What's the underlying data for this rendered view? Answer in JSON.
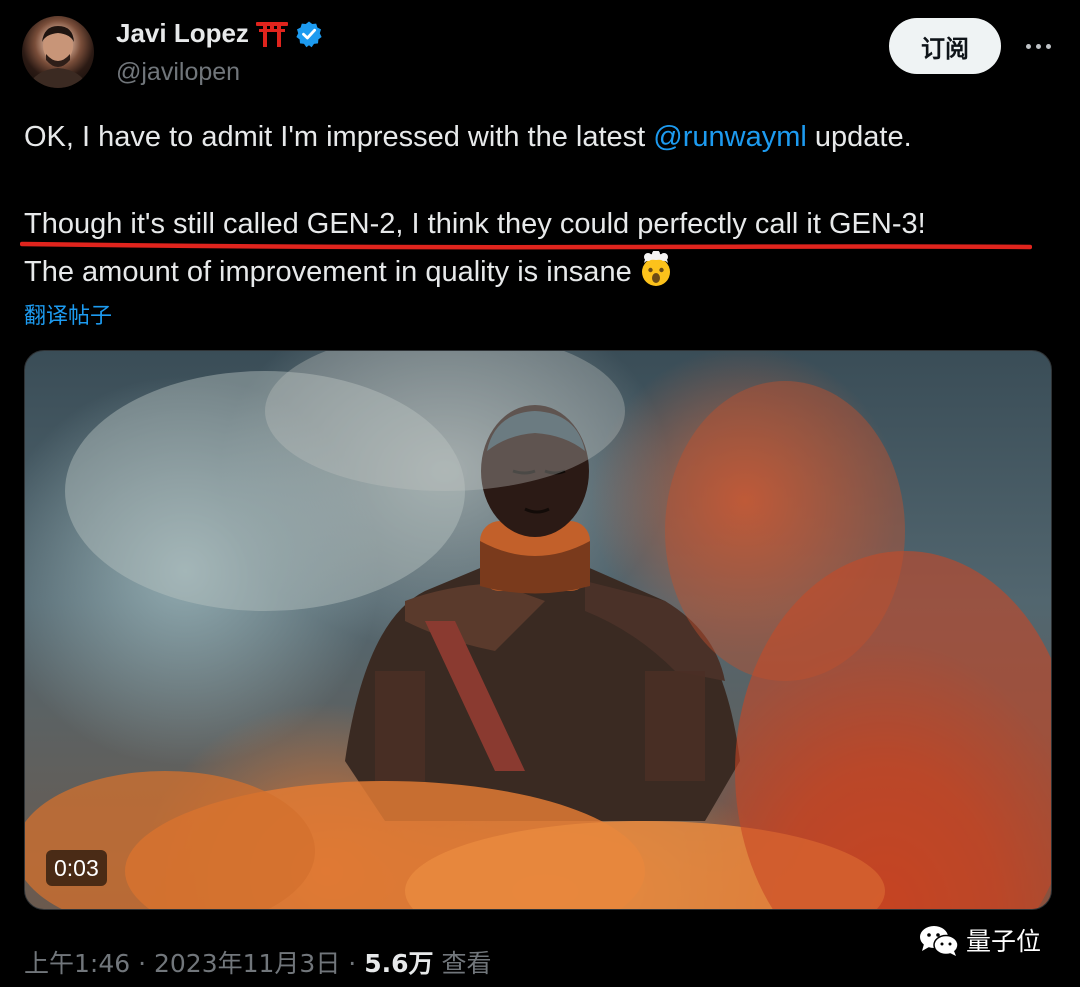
{
  "author": {
    "name": "Javi Lopez",
    "name_emoji": "⛩️",
    "handle": "@javilopen",
    "verified": true
  },
  "actions": {
    "subscribe_label": "订阅",
    "more_icon": "more-horizontal-icon"
  },
  "tweet": {
    "line1_before": "OK, I have to admit I'm impressed with the latest ",
    "mention": "@runwayml",
    "line1_after": " update.",
    "line2": "Though it's still called GEN-2, I think they could perfectly call it GEN-3!",
    "line3": "The amount of improvement in quality is insane",
    "line3_emoji": "🤯",
    "translate_label": "翻译帖子"
  },
  "media": {
    "duration": "0:03"
  },
  "meta": {
    "time": "上午1:46",
    "date": "2023年11月3日",
    "views_count": "5.6万",
    "views_label": "查看",
    "separator": "·"
  },
  "watermark": {
    "text": "量子位",
    "icon": "wechat-icon"
  },
  "colors": {
    "background": "#000000",
    "text": "#e7e9ea",
    "secondary": "#71767b",
    "link": "#1d9bf0",
    "highlight_line": "#e0241d"
  }
}
